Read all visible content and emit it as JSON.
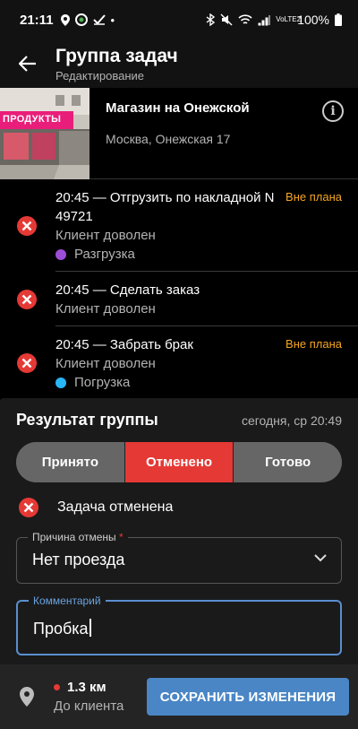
{
  "status_bar": {
    "time": "21:11",
    "battery": "100%",
    "network": "VoLTE2"
  },
  "app_bar": {
    "title": "Группа задач",
    "subtitle": "Редактирование"
  },
  "store": {
    "sign_text": "ПРОДУКТЫ",
    "name": "Магазин на Онежской",
    "address": "Москва, Онежская 17"
  },
  "tasks": [
    {
      "title": "20:45 — Отгрузить по накладной N 49721",
      "desc": "Клиент доволен",
      "flag": "Вне плана",
      "tag": "Разгрузка",
      "tag_color": "#9c4dd8"
    },
    {
      "title": "20:45 — Сделать заказ",
      "desc": "Клиент доволен",
      "flag": "",
      "tag": "",
      "tag_color": ""
    },
    {
      "title": "20:45 — Забрать брак",
      "desc": "Клиент доволен",
      "flag": "Вне плана",
      "tag": "Погрузка",
      "tag_color": "#29b6f6"
    }
  ],
  "result": {
    "title": "Результат группы",
    "time": "сегодня, ср 20:49",
    "options": [
      "Принято",
      "Отменено",
      "Готово"
    ],
    "selected": "Отменено",
    "status_text": "Задача отменена"
  },
  "cancel_reason": {
    "label": "Причина отмены",
    "required_mark": "*",
    "value": "Нет проезда"
  },
  "comment": {
    "label": "Комментарий",
    "value": "Пробка"
  },
  "bottom": {
    "distance": "1.3 км",
    "distance_label": "До клиента",
    "save_label": "СОХРАНИТЬ ИЗМЕНЕНИЯ"
  },
  "colors": {
    "accent": "#4a86c5",
    "cancel_red": "#e53935",
    "flag_orange": "#f5a623"
  }
}
